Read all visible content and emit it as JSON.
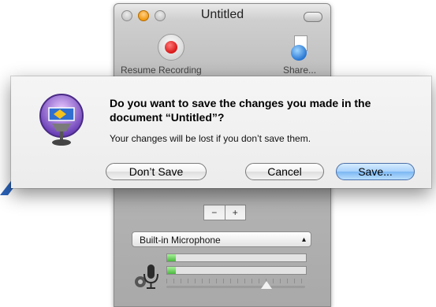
{
  "window": {
    "title": "Untitled",
    "toolbar": {
      "resume_label": "Resume Recording",
      "share_label": "Share..."
    }
  },
  "controls": {
    "stepper_minus": "−",
    "stepper_plus": "+",
    "input_source": "Built-in Microphone",
    "level_bar_1": 0.06,
    "level_bar_2": 0.06,
    "volume": 0.72
  },
  "alert": {
    "title": "Do you want to save the changes you made in the document “Untitled”?",
    "message": "Your changes will be lost if you don’t save them.",
    "dont_save_label": "Don’t Save",
    "cancel_label": "Cancel",
    "save_label": "Save..."
  },
  "colors": {
    "default_button": "#7cb7f3",
    "record_dot": "#d81414",
    "level_fill": "#4bb83f",
    "accent_blue": "#2a62b8"
  },
  "icons": {
    "app": "keynote-podium-icon",
    "share": "share-globe-icon",
    "microphone": "microphone-gear-icon"
  }
}
